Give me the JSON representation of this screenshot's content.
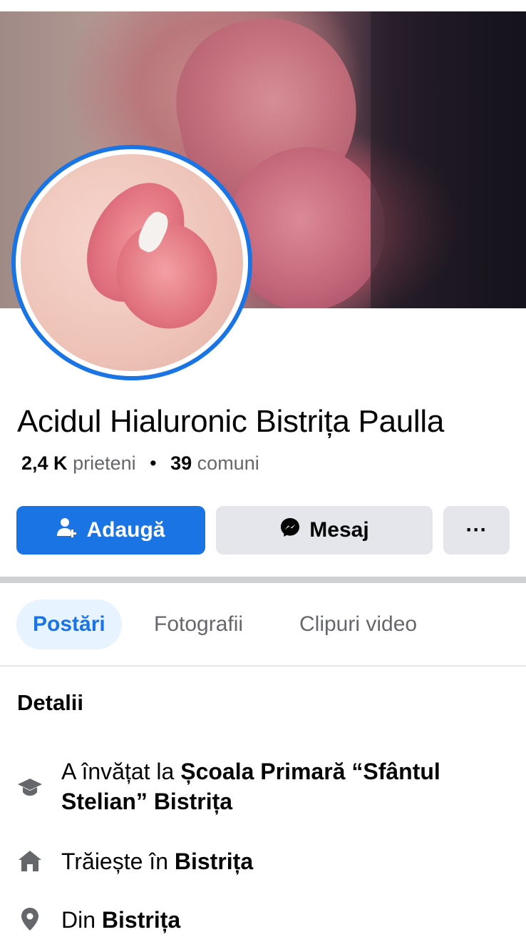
{
  "profile": {
    "name": "Acidul Hialuronic Bistrița Paulla",
    "friends_count": "2,4 K",
    "friends_label": "prieteni",
    "separator": "•",
    "mutual_count": "39",
    "mutual_label": "comuni"
  },
  "actions": {
    "add_label": "Adaugă",
    "message_label": "Mesaj",
    "more_label": "···"
  },
  "tabs": [
    {
      "label": "Postări",
      "active": true
    },
    {
      "label": "Fotografii",
      "active": false
    },
    {
      "label": "Clipuri video",
      "active": false
    }
  ],
  "details": {
    "title": "Detalii",
    "education_prefix": "A învățat la ",
    "education_place": "Școala Primară “Sfântul Stelian” Bistrița",
    "lives_prefix": "Trăiește în ",
    "lives_place": "Bistrița",
    "from_prefix": "Din ",
    "from_place": "Bistrița"
  },
  "colors": {
    "accent": "#1b74e4",
    "button_secondary": "#e4e6eb",
    "tab_active_bg": "#e7f3ff",
    "text_secondary": "#65676b"
  },
  "icons": {
    "add": "add-friend-icon",
    "message": "messenger-icon",
    "more": "more-icon",
    "education": "graduation-cap-icon",
    "home": "home-icon",
    "location": "location-pin-icon"
  }
}
